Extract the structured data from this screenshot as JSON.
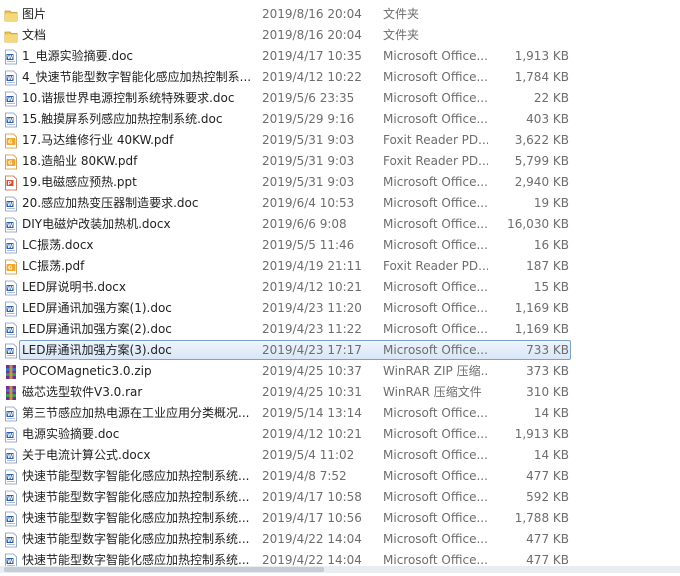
{
  "files": [
    {
      "name": "图片",
      "date": "2019/8/16 20:04",
      "type": "文件夹",
      "size": "",
      "icon": "folder-icon"
    },
    {
      "name": "文档",
      "date": "2019/8/16 20:04",
      "type": "文件夹",
      "size": "",
      "icon": "folder-icon"
    },
    {
      "name": "1_电源实验摘要.doc",
      "date": "2019/4/17 10:35",
      "type": "Microsoft Office...",
      "size": "1,913 KB",
      "icon": "word-icon"
    },
    {
      "name": "4_快速节能型数字智能化感应加热控制系...",
      "date": "2019/4/12 10:22",
      "type": "Microsoft Office...",
      "size": "1,784 KB",
      "icon": "word-icon"
    },
    {
      "name": "10.谐振世界电源控制系统特殊要求.doc",
      "date": "2019/5/6 23:35",
      "type": "Microsoft Office...",
      "size": "22 KB",
      "icon": "word-icon"
    },
    {
      "name": "15.触摸屏系列感应加热控制系统.doc",
      "date": "2019/5/29 9:16",
      "type": "Microsoft Office...",
      "size": "403 KB",
      "icon": "word-icon"
    },
    {
      "name": "17.马达维修行业 40KW.pdf",
      "date": "2019/5/31 9:03",
      "type": "Foxit Reader PD...",
      "size": "3,622 KB",
      "icon": "pdf-icon"
    },
    {
      "name": "18.造船业 80KW.pdf",
      "date": "2019/5/31 9:03",
      "type": "Foxit Reader PD...",
      "size": "5,799 KB",
      "icon": "pdf-icon"
    },
    {
      "name": "19.电磁感应预热.ppt",
      "date": "2019/5/31 9:03",
      "type": "Microsoft Office...",
      "size": "2,940 KB",
      "icon": "ppt-icon"
    },
    {
      "name": "20.感应加热变压器制造要求.doc",
      "date": "2019/6/4 10:53",
      "type": "Microsoft Office...",
      "size": "19 KB",
      "icon": "word-icon"
    },
    {
      "name": "DIY电磁炉改装加热机.docx",
      "date": "2019/6/6 9:08",
      "type": "Microsoft Office...",
      "size": "16,030 KB",
      "icon": "word-icon"
    },
    {
      "name": "LC振荡.docx",
      "date": "2019/5/5 11:46",
      "type": "Microsoft Office...",
      "size": "16 KB",
      "icon": "word-icon"
    },
    {
      "name": "LC振荡.pdf",
      "date": "2019/4/19 21:11",
      "type": "Foxit Reader PD...",
      "size": "187 KB",
      "icon": "pdf-icon"
    },
    {
      "name": "LED屏说明书.docx",
      "date": "2019/4/12 10:21",
      "type": "Microsoft Office...",
      "size": "15 KB",
      "icon": "word-icon"
    },
    {
      "name": "LED屏通讯加强方案(1).doc",
      "date": "2019/4/23 11:20",
      "type": "Microsoft Office...",
      "size": "1,169 KB",
      "icon": "word-icon"
    },
    {
      "name": "LED屏通讯加强方案(2).doc",
      "date": "2019/4/23 11:22",
      "type": "Microsoft Office...",
      "size": "1,169 KB",
      "icon": "word-icon"
    },
    {
      "name": "LED屏通讯加强方案(3).doc",
      "date": "2019/4/23 17:17",
      "type": "Microsoft Office...",
      "size": "733 KB",
      "icon": "word-icon",
      "selected": true
    },
    {
      "name": "POCOMagnetic3.0.zip",
      "date": "2019/4/25 10:37",
      "type": "WinRAR ZIP 压缩...",
      "size": "373 KB",
      "icon": "winrar-icon"
    },
    {
      "name": "磁芯选型软件V3.0.rar",
      "date": "2019/4/25 10:31",
      "type": "WinRAR 压缩文件",
      "size": "310 KB",
      "icon": "winrar-icon"
    },
    {
      "name": "第三节感应加热电源在工业应用分类概况...",
      "date": "2019/5/14 13:14",
      "type": "Microsoft Office...",
      "size": "14 KB",
      "icon": "word-icon"
    },
    {
      "name": "电源实验摘要.doc",
      "date": "2019/4/12 10:21",
      "type": "Microsoft Office...",
      "size": "1,913 KB",
      "icon": "word-icon"
    },
    {
      "name": "关于电流计算公式.docx",
      "date": "2019/5/4 11:02",
      "type": "Microsoft Office...",
      "size": "14 KB",
      "icon": "word-icon"
    },
    {
      "name": "快速节能型数字智能化感应加热控制系统...",
      "date": "2019/4/8 7:52",
      "type": "Microsoft Office...",
      "size": "477 KB",
      "icon": "word-icon"
    },
    {
      "name": "快速节能型数字智能化感应加热控制系统...",
      "date": "2019/4/17 10:58",
      "type": "Microsoft Office...",
      "size": "592 KB",
      "icon": "word-icon"
    },
    {
      "name": "快速节能型数字智能化感应加热控制系统...",
      "date": "2019/4/17 10:56",
      "type": "Microsoft Office...",
      "size": "1,788 KB",
      "icon": "word-icon"
    },
    {
      "name": "快速节能型数字智能化感应加热控制系统...",
      "date": "2019/4/22 14:04",
      "type": "Microsoft Office...",
      "size": "477 KB",
      "icon": "word-icon"
    },
    {
      "name": "快速节能型数字智能化感应加热控制系统...",
      "date": "2019/4/22 14:04",
      "type": "Microsoft Office...",
      "size": "477 KB",
      "icon": "word-icon"
    }
  ]
}
